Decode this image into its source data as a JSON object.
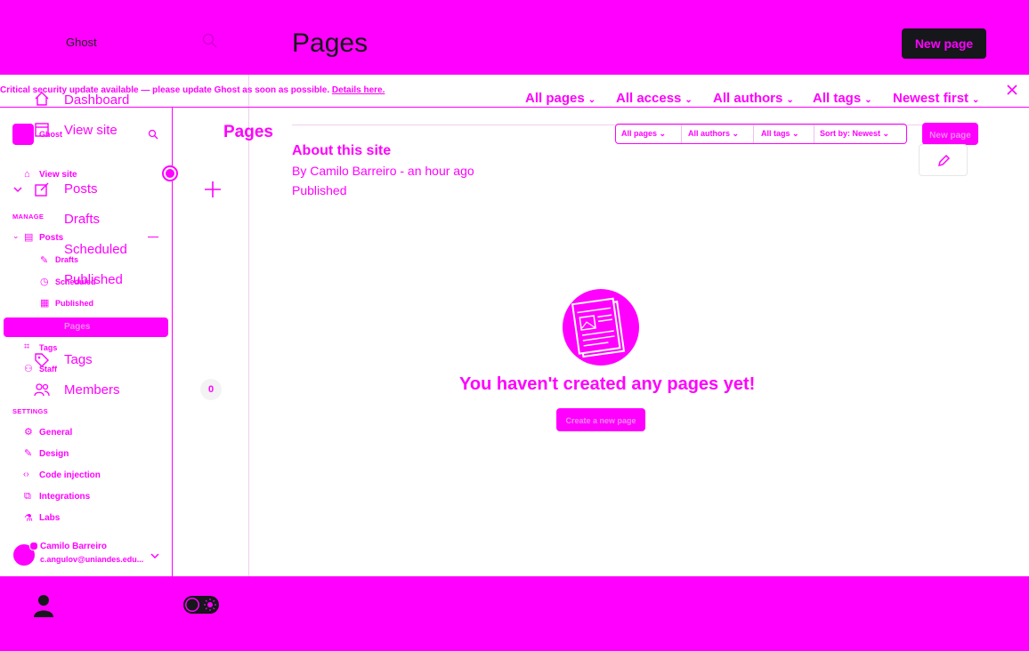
{
  "app": {
    "name": "Ghost",
    "page_title": "Pages",
    "new_page_label": "New page"
  },
  "overlay_nav": {
    "dashboard": "Dashboard",
    "view_site": "View site",
    "posts": "Posts",
    "drafts": "Drafts",
    "scheduled": "Scheduled",
    "published": "Published",
    "tags": "Tags",
    "members": "Members",
    "members_count": "0"
  },
  "banner": {
    "text": "Critical security update available — please update Ghost as soon as possible.",
    "link": "Details here."
  },
  "filters": {
    "all_pages": "All pages",
    "all_access": "All access",
    "all_authors": "All authors",
    "all_tags": "All tags",
    "sort": "Newest first"
  },
  "small_filters": {
    "all_pages": "All pages",
    "all_authors": "All authors",
    "all_tags": "All tags",
    "sort": "Sort by: Newest"
  },
  "sidebar": {
    "site_name": "Ghost",
    "view_site": "View site",
    "manage_label": "MANAGE",
    "posts": "Posts",
    "drafts": "Drafts",
    "scheduled": "Scheduled",
    "published": "Published",
    "pages": "Pages",
    "tags": "Tags",
    "staff": "Staff",
    "settings_label": "SETTINGS",
    "general": "General",
    "design": "Design",
    "code_injection": "Code injection",
    "integrations": "Integrations",
    "labs": "Labs",
    "user_name": "Camilo Barreiro",
    "user_email": "c.angulov@uniandes.edu..."
  },
  "main": {
    "heading": "Pages",
    "page_title": "About this site",
    "meta": "By Camilo Barreiro - an hour ago",
    "status": "Published",
    "empty_text": "You haven't created any pages yet!",
    "empty_button": "Create a new page",
    "top_new_page": "New page"
  },
  "colors": {
    "accent": "#ff00ff",
    "dark_button": "#15171a"
  },
  "icons": [
    "home-icon",
    "search-icon",
    "edit-icon",
    "clock-icon",
    "tag-icon",
    "people-icon",
    "gear-icon",
    "close-icon",
    "plus-icon",
    "pencil-icon",
    "user-icon",
    "toggle-icon"
  ]
}
